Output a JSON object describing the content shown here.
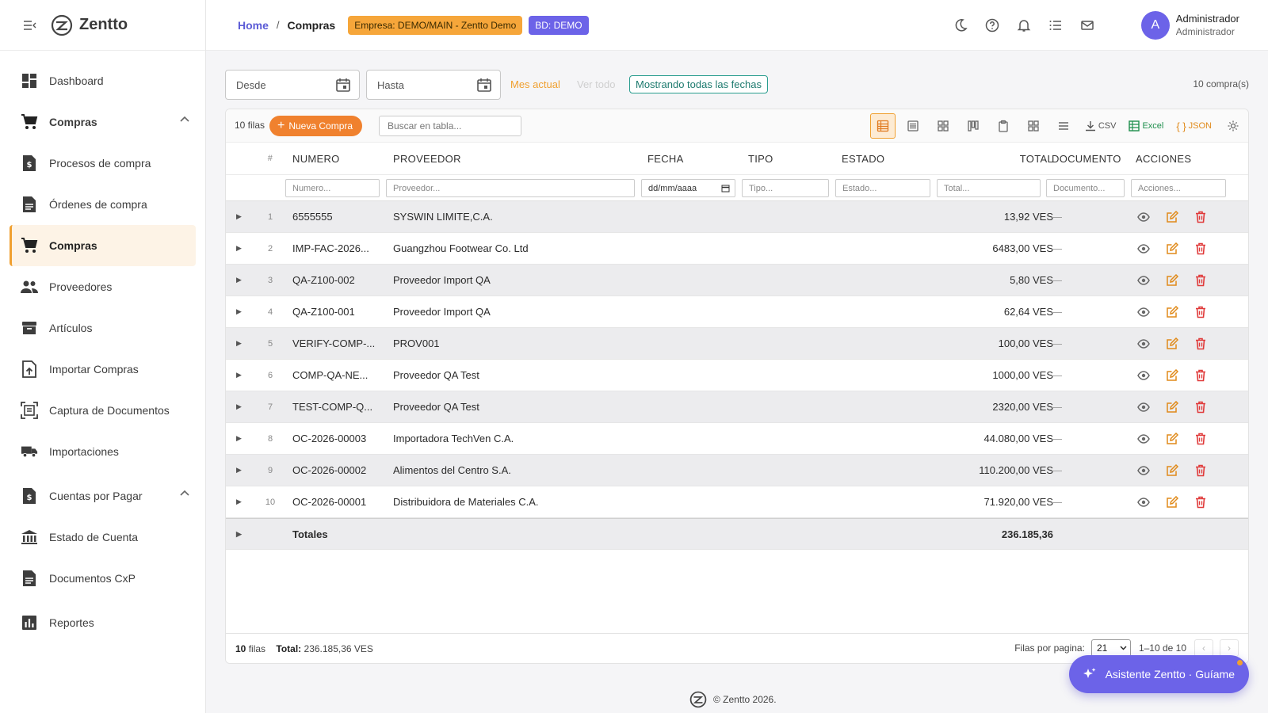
{
  "app": {
    "name": "Zentto"
  },
  "sidebar": {
    "items": [
      {
        "label": "Dashboard",
        "icon": "dashboard-icon"
      },
      {
        "label": "Compras",
        "icon": "cart-icon",
        "group": true,
        "expanded": true
      },
      {
        "label": "Procesos de compra",
        "icon": "document-dollar-icon"
      },
      {
        "label": "Órdenes de compra",
        "icon": "document-icon"
      },
      {
        "label": "Compras",
        "icon": "cart-icon",
        "active": true
      },
      {
        "label": "Proveedores",
        "icon": "people-icon"
      },
      {
        "label": "Artículos",
        "icon": "archive-icon"
      },
      {
        "label": "Importar Compras",
        "icon": "upload-file-icon"
      },
      {
        "label": "Captura de Documentos",
        "icon": "scan-document-icon"
      },
      {
        "label": "Importaciones",
        "icon": "truck-icon"
      },
      {
        "label": "Cuentas por Pagar",
        "icon": "document-dollar-icon",
        "expanded": true
      },
      {
        "label": "Estado de Cuenta",
        "icon": "bank-icon"
      },
      {
        "label": "Documentos CxP",
        "icon": "document-icon"
      },
      {
        "label": "Reportes",
        "icon": "chart-icon"
      }
    ]
  },
  "header": {
    "breadcrumb_home": "Home",
    "breadcrumb_sep": "/",
    "breadcrumb_current": "Compras",
    "empresa_chip": "Empresa: DEMO/MAIN - Zentto Demo",
    "bd_chip": "BD: DEMO",
    "user_initial": "A",
    "user_name": "Administrador",
    "user_role": "Administrador"
  },
  "filters": {
    "desde": "Desde",
    "hasta": "Hasta",
    "mes_actual": "Mes actual",
    "ver_todo": "Ver todo",
    "mostrando": "Mostrando todas las fechas",
    "count": "10 compra(s)"
  },
  "toolbar": {
    "rows": "10 filas",
    "new_label": "Nueva Compra",
    "search_placeholder": "Buscar en tabla...",
    "csv": "CSV",
    "excel": "Excel",
    "json": "JSON"
  },
  "table": {
    "columns": {
      "idx": "#",
      "numero": "NUMERO",
      "proveedor": "PROVEEDOR",
      "fecha": "FECHA",
      "tipo": "TIPO",
      "estado": "ESTADO",
      "total": "TOTAL",
      "documento": "DOCUMENTO",
      "acciones": "ACCIONES"
    },
    "filters": {
      "numero": "Numero...",
      "proveedor": "Proveedor...",
      "fecha": "dd/mm/aaaa",
      "tipo": "Tipo...",
      "estado": "Estado...",
      "total": "Total...",
      "documento": "Documento...",
      "acciones": "Acciones..."
    },
    "rows": [
      {
        "idx": "1",
        "numero": "6555555",
        "proveedor": "SYSWIN LIMITE,C.A.",
        "total": "13,92 VES",
        "documento": "—"
      },
      {
        "idx": "2",
        "numero": "IMP-FAC-2026...",
        "proveedor": "Guangzhou Footwear Co. Ltd",
        "total": "6483,00 VES",
        "documento": "—"
      },
      {
        "idx": "3",
        "numero": "QA-Z100-002",
        "proveedor": "Proveedor Import QA",
        "total": "5,80 VES",
        "documento": "—"
      },
      {
        "idx": "4",
        "numero": "QA-Z100-001",
        "proveedor": "Proveedor Import QA",
        "total": "62,64 VES",
        "documento": "—"
      },
      {
        "idx": "5",
        "numero": "VERIFY-COMP-...",
        "proveedor": "PROV001",
        "total": "100,00 VES",
        "documento": "—"
      },
      {
        "idx": "6",
        "numero": "COMP-QA-NE...",
        "proveedor": "Proveedor QA Test",
        "total": "1000,00 VES",
        "documento": "—"
      },
      {
        "idx": "7",
        "numero": "TEST-COMP-Q...",
        "proveedor": "Proveedor QA Test",
        "total": "2320,00 VES",
        "documento": "—"
      },
      {
        "idx": "8",
        "numero": "OC-2026-00003",
        "proveedor": "Importadora TechVen C.A.",
        "total": "44.080,00 VES",
        "documento": "—"
      },
      {
        "idx": "9",
        "numero": "OC-2026-00002",
        "proveedor": "Alimentos del Centro S.A.",
        "total": "110.200,00 VES",
        "documento": "—"
      },
      {
        "idx": "10",
        "numero": "OC-2026-00001",
        "proveedor": "Distribuidora de Materiales C.A.",
        "total": "71.920,00 VES",
        "documento": "—"
      }
    ],
    "totals_label": "Totales",
    "totals_value": "236.185,36"
  },
  "pager": {
    "rows_count": "10",
    "rows_word": "filas",
    "total_label": "Total:",
    "total_value": "236.185,36 VES",
    "per_page_label": "Filas por pagina:",
    "per_page_value": "21",
    "range": "1–10 de 10"
  },
  "assistant": {
    "label": "Asistente Zentto · Guíame"
  },
  "footer": {
    "text": "© Zentto 2026."
  },
  "colors": {
    "accent": "#6c63e8",
    "orange": "#f0812e",
    "edit": "#e08a1a",
    "delete": "#e03a3a"
  }
}
